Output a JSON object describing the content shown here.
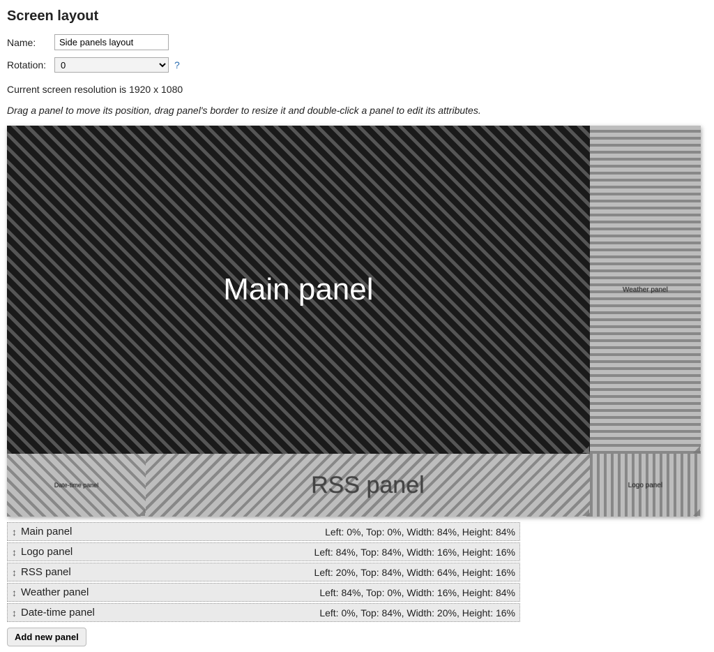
{
  "header": {
    "title": "Screen layout"
  },
  "form": {
    "name_label": "Name:",
    "name_value": "Side panels layout",
    "rotation_label": "Rotation:",
    "rotation_value": "0",
    "help_symbol": "?"
  },
  "resolution_text": "Current screen resolution is 1920 x 1080",
  "hint_text": "Drag a panel to move its position, drag panel's border to resize it and double-click a panel to edit its attributes.",
  "canvas": {
    "main_label": "Main panel",
    "weather_label": "Weather panel",
    "rss_label": "RSS panel",
    "datetime_label": "Date-time panel",
    "logo_label": "Logo panel"
  },
  "panel_list": [
    {
      "name": "Main panel",
      "coords": "Left: 0%, Top: 0%, Width: 84%, Height: 84%"
    },
    {
      "name": "Logo panel",
      "coords": "Left: 84%, Top: 84%, Width: 16%, Height: 16%"
    },
    {
      "name": "RSS panel",
      "coords": "Left: 20%, Top: 84%, Width: 64%, Height: 16%"
    },
    {
      "name": "Weather panel",
      "coords": "Left: 84%, Top: 0%, Width: 16%, Height: 84%"
    },
    {
      "name": "Date-time panel",
      "coords": "Left: 0%, Top: 84%, Width: 20%, Height: 16%"
    }
  ],
  "buttons": {
    "add_panel": "Add new panel"
  },
  "icons": {
    "drag_handle": "↕"
  }
}
